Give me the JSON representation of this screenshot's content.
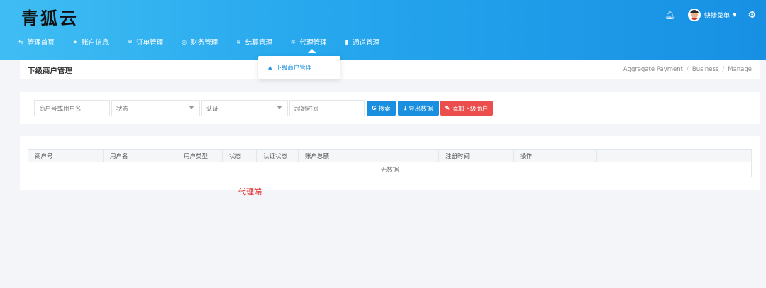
{
  "app": {
    "logo": "青狐云"
  },
  "nav": {
    "items": [
      {
        "icon": "⇆",
        "label": "管理首页"
      },
      {
        "icon": "✦",
        "label": "账户信息"
      },
      {
        "icon": "✉",
        "label": "订单管理"
      },
      {
        "icon": "◎",
        "label": "财务管理"
      },
      {
        "icon": "≋",
        "label": "结算管理"
      },
      {
        "icon": "≋",
        "label": "代理管理"
      },
      {
        "icon": "▮",
        "label": "通道管理"
      }
    ]
  },
  "header": {
    "user_label": "快捷菜单"
  },
  "dropdown": {
    "icon": "▲",
    "item": "下级商户管理"
  },
  "page": {
    "title": "下级商户管理",
    "breadcrumb": [
      "Aggregate Payment",
      "Business",
      "Manage"
    ]
  },
  "filters": {
    "keyword_placeholder": "商户号或用户名",
    "status_placeholder": "状态",
    "auth_placeholder": "认证",
    "start_time_placeholder": "起始时间",
    "search_label": "搜索",
    "export_label": "导出数据",
    "add_label": "添加下级商户",
    "search_icon": "G",
    "export_icon": "⤓",
    "add_icon": "✎"
  },
  "table": {
    "columns": [
      "商户号",
      "用户名",
      "用户类型",
      "状态",
      "认证状态",
      "账户总额",
      "注册时间",
      "操作",
      ""
    ],
    "empty_text": "无数据"
  },
  "annotation": "代理端",
  "colors": {
    "primary": "#1a8fe0",
    "danger": "#ec4d4d",
    "header_gradient_start": "#3fbdf3",
    "header_gradient_end": "#1790e3"
  }
}
